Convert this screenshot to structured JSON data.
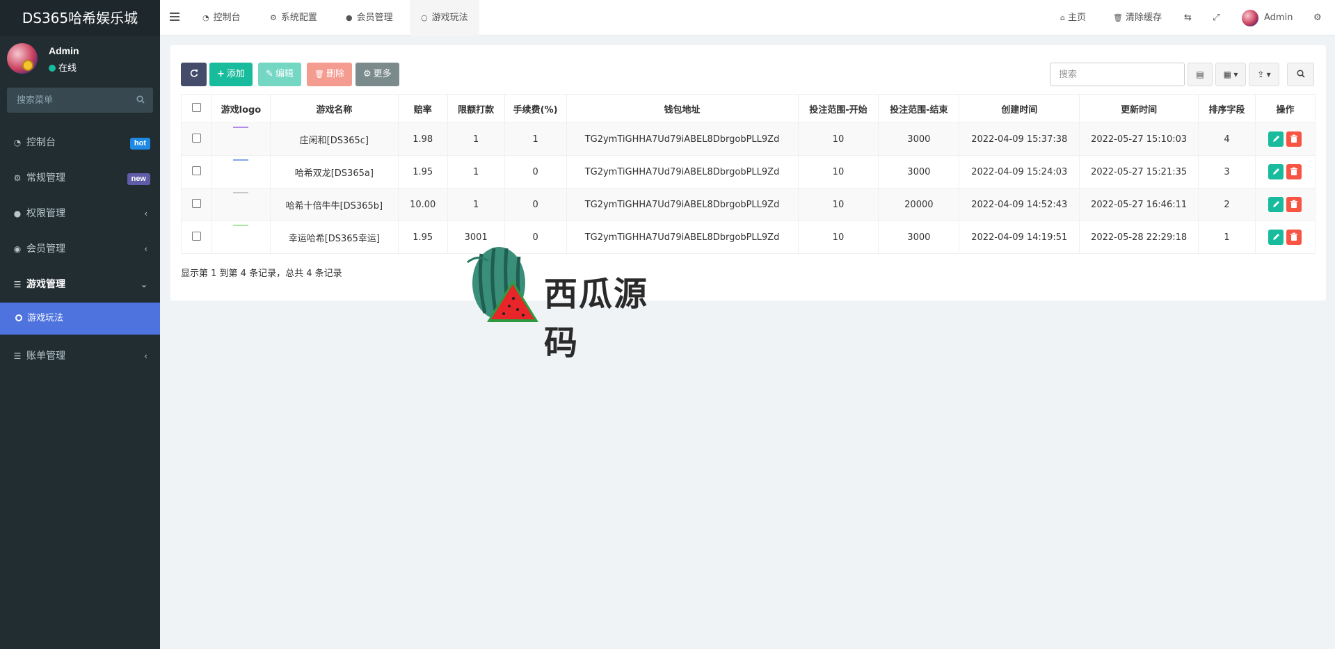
{
  "app": {
    "title": "DS365哈希娱乐城"
  },
  "user": {
    "name": "Admin",
    "status": "在线"
  },
  "sidebar": {
    "search_placeholder": "搜索菜单",
    "items": [
      {
        "label": "控制台",
        "icon": "dashboard-icon",
        "badge": "hot"
      },
      {
        "label": "常规管理",
        "icon": "cogs-icon",
        "badge": "new"
      },
      {
        "label": "权限管理",
        "icon": "group-icon"
      },
      {
        "label": "会员管理",
        "icon": "user-circle-icon"
      },
      {
        "label": "游戏管理",
        "icon": "list-icon"
      },
      {
        "label": "账单管理",
        "icon": "list-icon"
      }
    ],
    "sub_items": [
      {
        "label": "游戏玩法"
      }
    ]
  },
  "topbar": {
    "tabs": [
      {
        "label": "控制台",
        "icon": "dashboard-icon"
      },
      {
        "label": "系统配置",
        "icon": "cog-icon"
      },
      {
        "label": "会员管理",
        "icon": "user-icon"
      },
      {
        "label": "游戏玩法",
        "icon": "circle-icon"
      }
    ],
    "home": "主页",
    "clear_cache": "清除缓存",
    "admin": "Admin"
  },
  "toolbar": {
    "add": "添加",
    "edit": "编辑",
    "delete": "删除",
    "more": "更多",
    "search_placeholder": "搜索"
  },
  "table": {
    "headers": [
      "游戏logo",
      "游戏名称",
      "赔率",
      "限额打款",
      "手续费(%)",
      "钱包地址",
      "投注范围-开始",
      "投注范围-结束",
      "创建时间",
      "更新时间",
      "排序字段",
      "操作"
    ],
    "rows": [
      {
        "logo_color": "#b38be8",
        "name": "庄闲和[DS365c]",
        "odds": "1.98",
        "limit": "1",
        "fee": "1",
        "wallet": "TG2ymTiGHHA7Ud79iABEL8DbrgobPLL9Zd",
        "bet_start": "10",
        "bet_end": "3000",
        "created": "2022-04-09 15:37:38",
        "updated": "2022-05-27 15:10:03",
        "sort": "4"
      },
      {
        "logo_color": "#7fa8e6",
        "name": "哈希双龙[DS365a]",
        "odds": "1.95",
        "limit": "1",
        "fee": "0",
        "wallet": "TG2ymTiGHHA7Ud79iABEL8DbrgobPLL9Zd",
        "bet_start": "10",
        "bet_end": "3000",
        "created": "2022-04-09 15:24:03",
        "updated": "2022-05-27 15:21:35",
        "sort": "3"
      },
      {
        "logo_color": "#c8c8c8",
        "name": "哈希十倍牛牛[DS365b]",
        "odds": "10.00",
        "limit": "1",
        "fee": "0",
        "wallet": "TG2ymTiGHHA7Ud79iABEL8DbrgobPLL9Zd",
        "bet_start": "10",
        "bet_end": "20000",
        "created": "2022-04-09 14:52:43",
        "updated": "2022-05-27 16:46:11",
        "sort": "2"
      },
      {
        "logo_color": "#a8e6a0",
        "name": "幸运哈希[DS365幸运]",
        "odds": "1.95",
        "limit": "3001",
        "fee": "0",
        "wallet": "TG2ymTiGHHA7Ud79iABEL8DbrgobPLL9Zd",
        "bet_start": "10",
        "bet_end": "3000",
        "created": "2022-04-09 14:19:51",
        "updated": "2022-05-28 22:29:18",
        "sort": "1"
      }
    ]
  },
  "pagination": {
    "summary": "显示第 1 到第 4 条记录，总共 4 条记录"
  },
  "watermark": {
    "text": "西瓜源码"
  },
  "colors": {
    "accent": "#4e73df",
    "sidebar_bg": "#222d32",
    "success": "#18bc9c",
    "danger": "#f75444"
  }
}
